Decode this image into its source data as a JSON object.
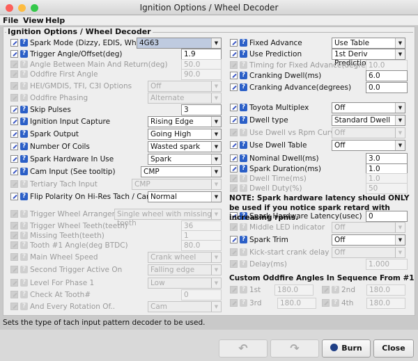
{
  "window": {
    "title": "Ignition Options / Wheel Decoder"
  },
  "menu": [
    "File",
    "View",
    "Help"
  ],
  "panel_title": "Ignition Options / Wheel Decoder",
  "left": [
    {
      "label": "Spark Mode (Dizzy, EDIS, Wheel)",
      "control": "combo",
      "value": "4G63",
      "enabled": true,
      "highlight": true
    },
    {
      "label": "Trigger Angle/Offset(deg)",
      "control": "text",
      "value": "1.9",
      "enabled": true
    },
    {
      "label": "Angle Between Main And Return(deg)",
      "control": "text",
      "value": "50.0",
      "enabled": false
    },
    {
      "label": "Oddfire First Angle",
      "control": "text",
      "value": "90.0",
      "enabled": false
    },
    {
      "label": "HEI/GMDIS, TFI, C3I Options",
      "control": "combo",
      "value": "Off",
      "enabled": false
    },
    {
      "label": "Oddfire Phasing",
      "control": "combo",
      "value": "Alternate",
      "enabled": false
    },
    {
      "label": "Skip Pulses",
      "control": "text",
      "value": "3",
      "enabled": true
    },
    {
      "label": "Ignition Input Capture",
      "control": "combo",
      "value": "Rising Edge",
      "enabled": true
    },
    {
      "label": "Spark Output",
      "control": "combo",
      "value": "Going High",
      "enabled": true
    },
    {
      "label": "Number Of Coils",
      "control": "combo",
      "value": "Wasted spark",
      "enabled": true
    },
    {
      "label": "Spark Hardware In Use",
      "control": "combo",
      "value": "Spark",
      "enabled": true
    },
    {
      "label": "Cam Input (See tooltip)",
      "control": "combo",
      "value": "CMP",
      "enabled": true
    },
    {
      "label": "Tertiary Tach Input",
      "control": "combo",
      "value": "CMP",
      "enabled": false
    },
    {
      "label": "Flip Polarity On Hi-Res Tach / Cam",
      "control": "combo",
      "value": "Normal",
      "enabled": true
    },
    {
      "label": "Trigger Wheel Arrangement",
      "control": "combo",
      "value": "Single wheel with missing tooth",
      "enabled": false
    },
    {
      "label": "Trigger Wheel Teeth(teeth)",
      "control": "text",
      "value": "36",
      "enabled": false
    },
    {
      "label": "Missing Teeth(teeth)",
      "control": "text",
      "value": "1",
      "enabled": false
    },
    {
      "label": "Tooth #1 Angle(deg BTDC)",
      "control": "text",
      "value": "80.0",
      "enabled": false
    },
    {
      "label": "Main Wheel Speed",
      "control": "combo",
      "value": "Crank wheel",
      "enabled": false
    },
    {
      "label": "Second Trigger Active On",
      "control": "combo",
      "value": "Falling edge",
      "enabled": false
    },
    {
      "label": "Level For Phase 1",
      "control": "combo",
      "value": "Low",
      "enabled": false
    },
    {
      "label": "Check At Tooth#",
      "control": "text",
      "value": "0",
      "enabled": false
    },
    {
      "label": "And Every Rotation Of..",
      "control": "combo",
      "value": "Cam",
      "enabled": false
    }
  ],
  "right": [
    {
      "label": "Fixed Advance",
      "control": "combo",
      "value": "Use Table",
      "enabled": true
    },
    {
      "label": "Use Prediction",
      "control": "combo",
      "value": "1st Deriv Prediction",
      "enabled": true
    },
    {
      "label": "Timing for Fixed Advance(degrees)",
      "control": "text",
      "value": "10.0",
      "enabled": false
    },
    {
      "label": "Cranking Dwell(ms)",
      "control": "text",
      "value": "6.0",
      "enabled": true
    },
    {
      "label": "Cranking Advance(degrees)",
      "control": "text",
      "value": "0.0",
      "enabled": true
    },
    {
      "label": "Toyota Multiplex",
      "control": "combo",
      "value": "Off",
      "enabled": true
    },
    {
      "label": "Dwell type",
      "control": "combo",
      "value": "Standard Dwell",
      "enabled": true
    },
    {
      "label": "Use Dwell vs Rpm Curve",
      "control": "combo",
      "value": "Off",
      "enabled": false
    },
    {
      "label": "Use Dwell Table",
      "control": "combo",
      "value": "Off",
      "enabled": true
    },
    {
      "label": "Nominal Dwell(ms)",
      "control": "text",
      "value": "3.0",
      "enabled": true
    },
    {
      "label": "Spark Duration(ms)",
      "control": "text",
      "value": "1.0",
      "enabled": true
    },
    {
      "label": "Dwell Time(ms)",
      "control": "text",
      "value": "1.0",
      "enabled": false
    },
    {
      "label": "Dwell Duty(%)",
      "control": "text",
      "value": "50",
      "enabled": false
    },
    {
      "label": "Spark Hardware Latency(usec)",
      "control": "text",
      "value": "0",
      "enabled": true
    },
    {
      "label": "Middle LED indicator",
      "control": "combo",
      "value": "Off",
      "enabled": false
    },
    {
      "label": "Spark Trim",
      "control": "combo",
      "value": "Off",
      "enabled": true
    },
    {
      "label": "Kick-start crank delay",
      "control": "combo",
      "value": "Off",
      "enabled": false
    },
    {
      "label": "Delay(ms)",
      "control": "text",
      "value": "1.000",
      "enabled": false
    }
  ],
  "note": "NOTE: Spark hardware latency should ONLY be used if you notice spark retard with increasing rpms.",
  "oddfire": {
    "title": "Custom Oddfire Angles In Sequence From #1",
    "items": [
      {
        "label": "1st",
        "value": "180.0"
      },
      {
        "label": "2nd",
        "value": "180.0"
      },
      {
        "label": "3rd",
        "value": "180.0"
      },
      {
        "label": "4th",
        "value": "180.0"
      }
    ]
  },
  "status": "Sets the type of tach input pattern decoder to be used.",
  "buttons": {
    "undo": "↶",
    "redo": "↷",
    "burn": "Burn",
    "close": "Close"
  },
  "colors": {
    "help_icon": "#2b5fc7",
    "highlight_field": "#bfcbe0",
    "disabled_text": "#9a9a9a"
  }
}
